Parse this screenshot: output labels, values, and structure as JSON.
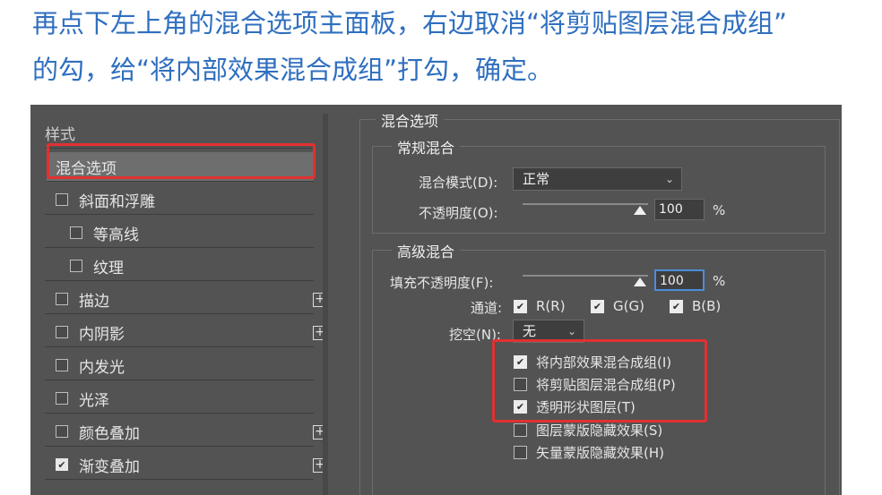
{
  "caption": {
    "line1": "再点下左上角的混合选项主面板，右边取消“将剪贴图层混合成组”",
    "line2": "的勾，给“将内部效果混合成组”打勾，确定。"
  },
  "styles_panel": {
    "header": "样式",
    "items": [
      {
        "label": "混合选项",
        "checkbox": false,
        "checked": false,
        "plus": false,
        "selected": true
      },
      {
        "label": "斜面和浮雕",
        "checkbox": true,
        "checked": false,
        "plus": false
      },
      {
        "label": "等高线",
        "checkbox": true,
        "checked": false,
        "plus": false,
        "indent": true
      },
      {
        "label": "纹理",
        "checkbox": true,
        "checked": false,
        "plus": false,
        "indent": true
      },
      {
        "label": "描边",
        "checkbox": true,
        "checked": false,
        "plus": true
      },
      {
        "label": "内阴影",
        "checkbox": true,
        "checked": false,
        "plus": true
      },
      {
        "label": "内发光",
        "checkbox": true,
        "checked": false,
        "plus": false
      },
      {
        "label": "光泽",
        "checkbox": true,
        "checked": false,
        "plus": false
      },
      {
        "label": "颜色叠加",
        "checkbox": true,
        "checked": false,
        "plus": true
      },
      {
        "label": "渐变叠加",
        "checkbox": true,
        "checked": true,
        "plus": true
      }
    ],
    "plus_glyph": "+",
    "check_glyph": "✔"
  },
  "blending": {
    "title": "混合选项",
    "general": {
      "title": "常规混合",
      "mode_label": "混合模式(D):",
      "mode_value": "正常",
      "opacity_label": "不透明度(O):",
      "opacity_value": "100",
      "percent": "%"
    },
    "advanced": {
      "title": "高级混合",
      "fill_label": "填充不透明度(F):",
      "fill_value": "100",
      "percent": "%",
      "channels_label": "通道:",
      "channels": [
        {
          "label": "R(R)",
          "checked": true
        },
        {
          "label": "G(G)",
          "checked": true
        },
        {
          "label": "B(B)",
          "checked": true
        }
      ],
      "knockout_label": "挖空(N):",
      "knockout_value": "无",
      "options": [
        {
          "label": "将内部效果混合成组(I)",
          "checked": true
        },
        {
          "label": "将剪贴图层混合成组(P)",
          "checked": false
        },
        {
          "label": "透明形状图层(T)",
          "checked": true
        },
        {
          "label": "图层蒙版隐藏效果(S)",
          "checked": false
        },
        {
          "label": "矢量蒙版隐藏效果(H)",
          "checked": false
        }
      ]
    },
    "chevron": "⌄"
  }
}
